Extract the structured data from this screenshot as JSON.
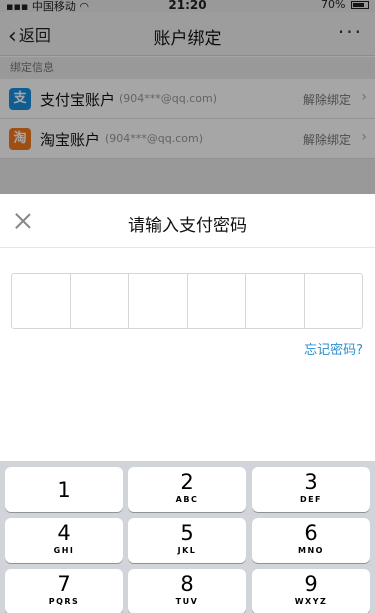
{
  "status_bar": {
    "carrier": "中国移动",
    "time": "21:20",
    "battery": "70%"
  },
  "nav": {
    "back_label": "返回",
    "title": "账户绑定",
    "more_label": "···"
  },
  "section_label": "绑定信息",
  "accounts": [
    {
      "icon": "支",
      "name": "支付宝账户",
      "email": "(904***@qq.com)",
      "action": "解除绑定"
    },
    {
      "icon": "淘",
      "name": "淘宝账户",
      "email": "(904***@qq.com)",
      "action": "解除绑定"
    }
  ],
  "sheet": {
    "title": "请输入支付密码",
    "forgot_password": "忘记密码?"
  },
  "keypad": [
    {
      "num": "1",
      "letters": ""
    },
    {
      "num": "2",
      "letters": "ABC"
    },
    {
      "num": "3",
      "letters": "DEF"
    },
    {
      "num": "4",
      "letters": "GHI"
    },
    {
      "num": "5",
      "letters": "JKL"
    },
    {
      "num": "6",
      "letters": "MNO"
    },
    {
      "num": "7",
      "letters": "PQRS"
    },
    {
      "num": "8",
      "letters": "TUV"
    },
    {
      "num": "9",
      "letters": "WXYZ"
    }
  ]
}
